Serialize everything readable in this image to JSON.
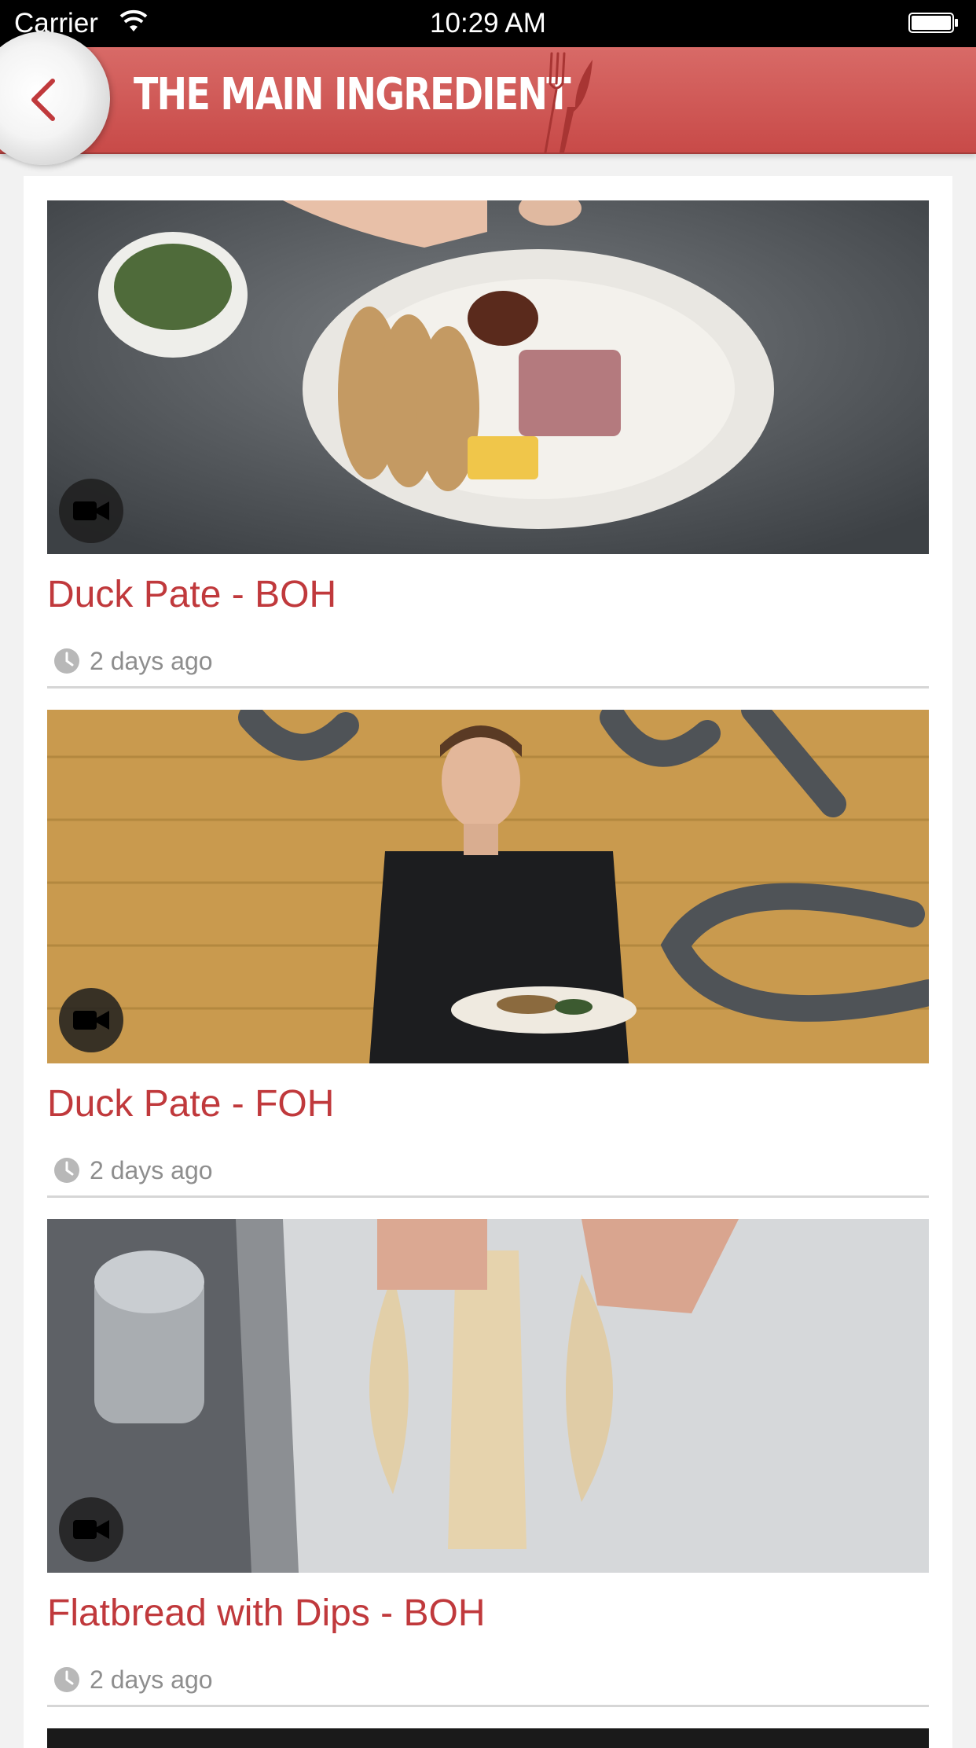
{
  "status_bar": {
    "carrier": "Carrier",
    "time": "10:29 AM"
  },
  "header": {
    "title": "THE MAIN INGREDIENT",
    "back_icon": "chevron-left-icon",
    "brand_color": "#d05a58"
  },
  "items": [
    {
      "title": "Duck Pate - BOH",
      "time_ago": "2 days ago",
      "icon": "video-camera-icon"
    },
    {
      "title": "Duck Pate - FOH",
      "time_ago": "2 days ago",
      "icon": "video-camera-icon"
    },
    {
      "title": "Flatbread with Dips - BOH",
      "time_ago": "2 days ago",
      "icon": "video-camera-icon"
    }
  ],
  "colors": {
    "title_red": "#c0393c",
    "meta_gray": "#8e8e8e",
    "background": "#f2f2f2"
  }
}
